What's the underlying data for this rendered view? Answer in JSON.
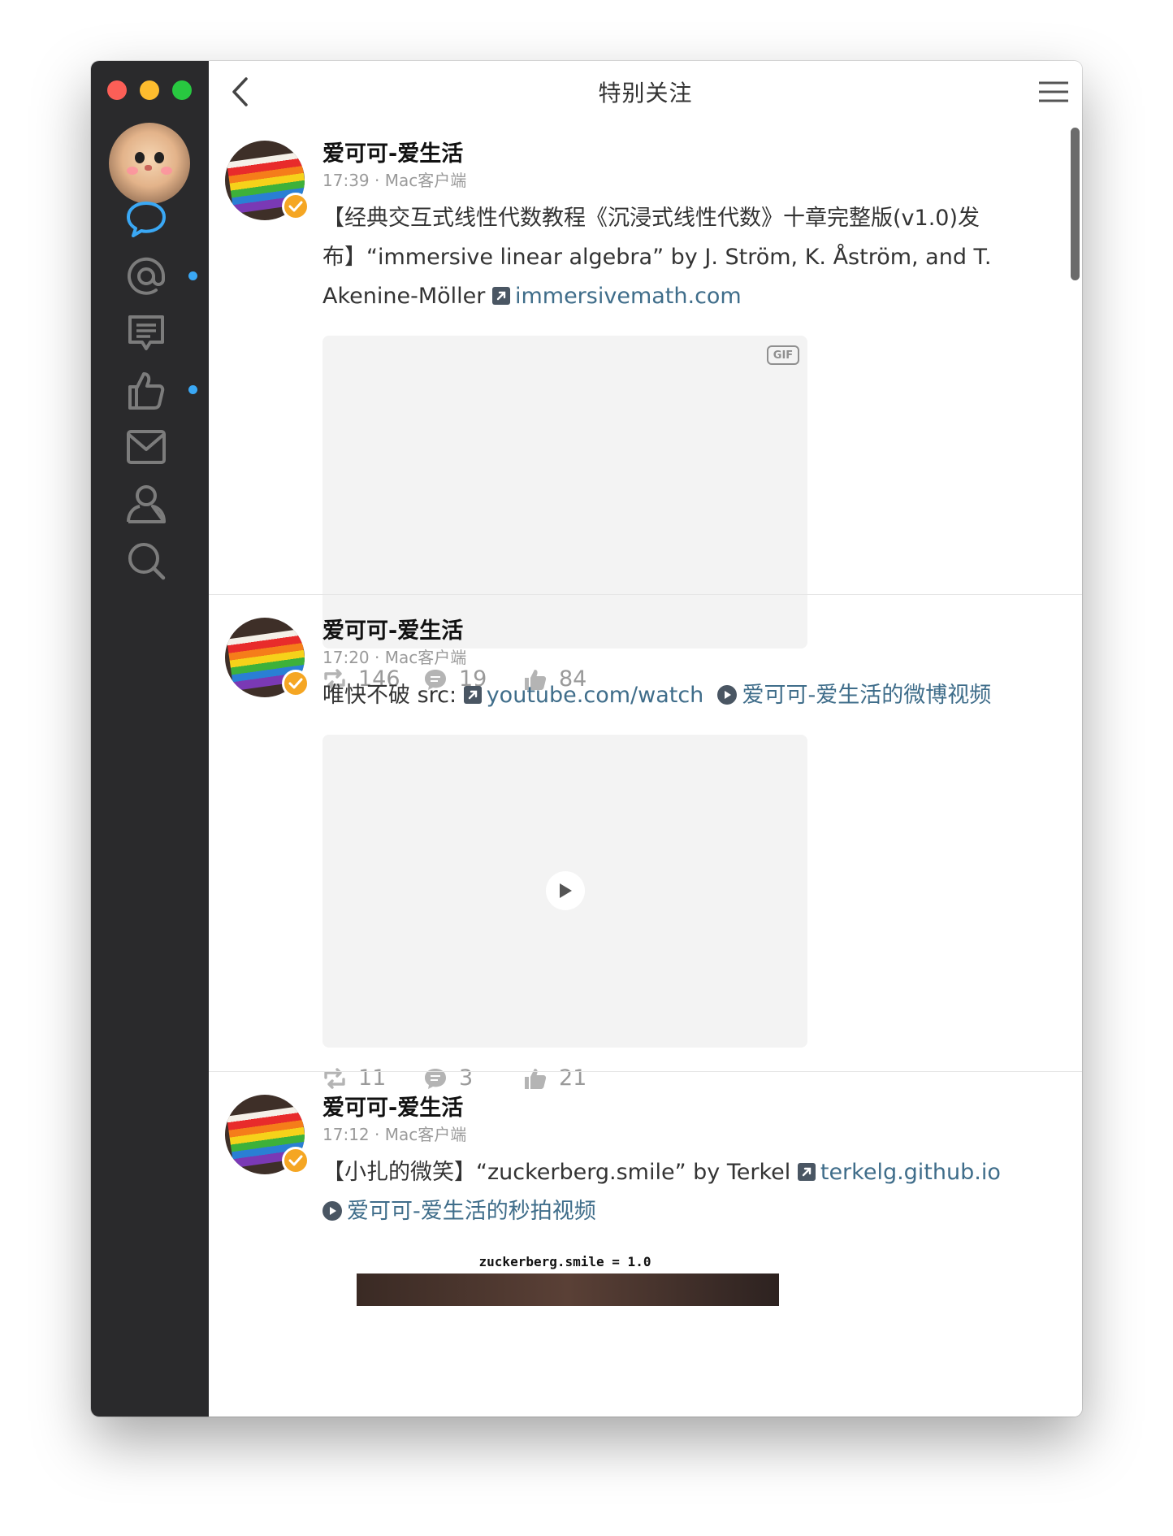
{
  "window": {
    "title": "特别关注"
  },
  "sidebar": {
    "items": [
      {
        "name": "messages",
        "icon": "speech-bubble-icon",
        "active": true
      },
      {
        "name": "mentions",
        "icon": "at-icon",
        "badge": true
      },
      {
        "name": "comments",
        "icon": "comment-list-icon"
      },
      {
        "name": "likes",
        "icon": "thumb-up-icon",
        "badge": true
      },
      {
        "name": "mail",
        "icon": "envelope-icon"
      },
      {
        "name": "profile",
        "icon": "user-icon"
      },
      {
        "name": "search",
        "icon": "search-icon"
      }
    ],
    "accent_color": "#3aa8f5"
  },
  "posts": [
    {
      "author": "爱可可-爱生活",
      "meta": "17:39 · Mac客户端",
      "text_before": "【经典交互式线性代数教程《沉浸式线性代数》十章完整版(v1.0)发布】“immersive linear algebra” by J. Ström, K. Åström, and T. Akenine-Möller",
      "link": "immersivemath.com",
      "media_badge": "GIF",
      "reposts": "146",
      "comments": "19",
      "likes": "84"
    },
    {
      "author": "爱可可-爱生活",
      "meta": "17:20 · Mac客户端",
      "text_before": "唯快不破 src:",
      "link": "youtube.com/watch",
      "video_link": "爱可可-爱生活的微博视频",
      "reposts": "11",
      "comments": "3",
      "likes": "21"
    },
    {
      "author": "爱可可-爱生活",
      "meta": "17:12 · Mac客户端",
      "text_before": "【小扎的微笑】“zuckerberg.smile” by Terkel",
      "link": "terkelg.github.io",
      "video_link": "爱可可-爱生活的秒拍视频",
      "media_caption": "zuckerberg.smile = 1.0"
    }
  ]
}
